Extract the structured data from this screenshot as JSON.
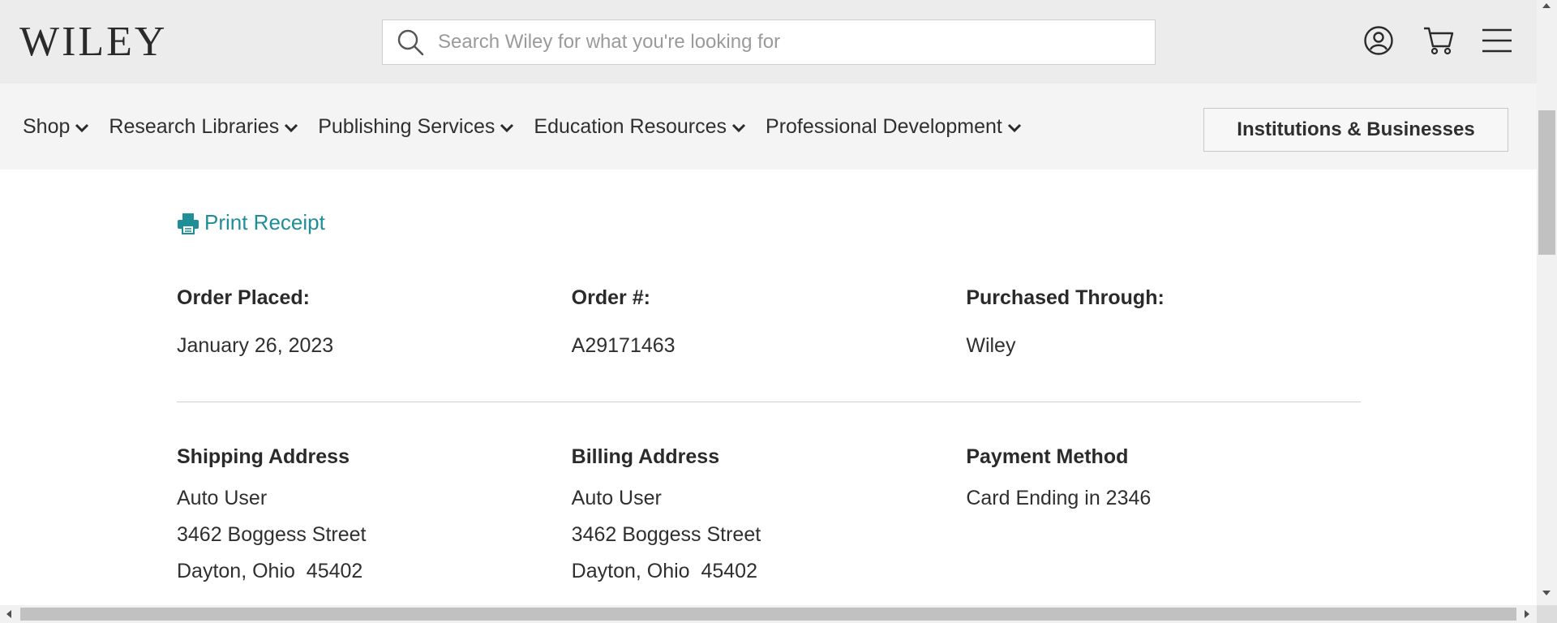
{
  "header": {
    "logo": "WILEY",
    "search": {
      "placeholder": "Search Wiley for what you're looking for"
    },
    "icons": [
      "account-icon",
      "cart-icon",
      "menu-icon"
    ]
  },
  "nav": {
    "items": [
      {
        "label": "Shop"
      },
      {
        "label": "Research Libraries"
      },
      {
        "label": "Publishing Services"
      },
      {
        "label": "Education Resources"
      },
      {
        "label": "Professional Development"
      }
    ],
    "institutions_button": "Institutions & Businesses"
  },
  "receipt": {
    "print_label": "Print Receipt",
    "order_placed": {
      "label": "Order Placed:",
      "value": "January 26, 2023"
    },
    "order_number": {
      "label": "Order #:",
      "value": "A29171463"
    },
    "purchased_through": {
      "label": "Purchased Through:",
      "value": "Wiley"
    },
    "shipping": {
      "label": "Shipping Address",
      "lines": [
        "Auto User",
        "3462 Boggess Street",
        "Dayton, Ohio  45402"
      ]
    },
    "billing": {
      "label": "Billing Address",
      "lines": [
        "Auto User",
        "3462 Boggess Street",
        "Dayton, Ohio  45402"
      ]
    },
    "payment": {
      "label": "Payment Method",
      "value": "Card Ending in 2346"
    }
  },
  "colors": {
    "link": "#1f8e96",
    "header_bg": "#ececec",
    "nav_bg": "#f4f4f4"
  }
}
